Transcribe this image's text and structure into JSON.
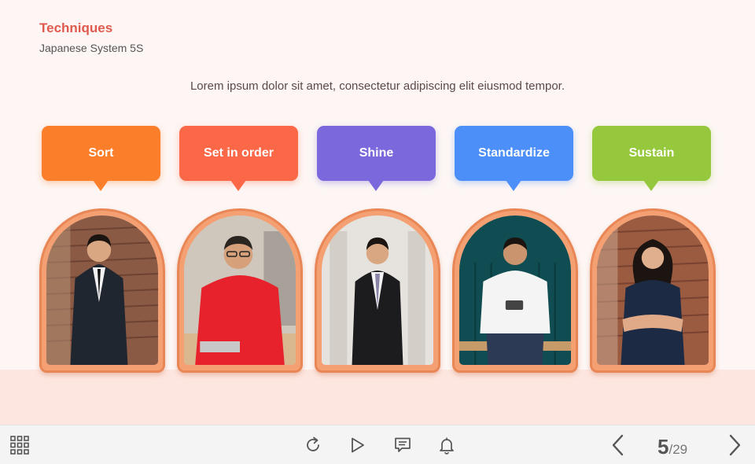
{
  "header": {
    "title": "Techniques",
    "subtitle": "Japanese System 5S"
  },
  "intro_text": "Lorem ipsum dolor sit amet, consectetur adipiscing elit eiusmod tempor.",
  "steps": [
    {
      "label": "Sort",
      "color": "#fb7e2a"
    },
    {
      "label": "Set in order",
      "color": "#fb6848"
    },
    {
      "label": "Shine",
      "color": "#7a68dc"
    },
    {
      "label": "Standardize",
      "color": "#4d8ff9"
    },
    {
      "label": "Sustain",
      "color": "#96c83e"
    }
  ],
  "colors": {
    "title": "#e05a4e",
    "arch_frame": "#f4a072",
    "floor": "#fde6df",
    "background": "#fdf6f4"
  },
  "navbar": {
    "menu_icon": "grid-menu-icon",
    "replay_icon": "replay-icon",
    "play_icon": "play-icon",
    "notes_icon": "notes-icon",
    "notify_icon": "bell-icon",
    "prev_icon": "chevron-left-icon",
    "next_icon": "chevron-right-icon",
    "page_current": "5",
    "page_total": "/29"
  }
}
